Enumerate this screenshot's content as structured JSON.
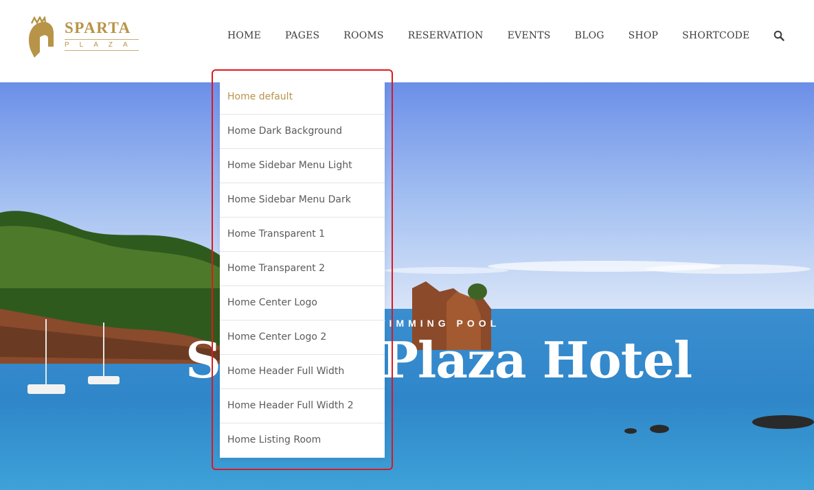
{
  "brand": {
    "name": "SPARTA",
    "sub": "PLAZA",
    "accent_color": "#b89448",
    "icon": "spartan-helmet-icon"
  },
  "nav": {
    "items": [
      "Home",
      "Pages",
      "Rooms",
      "Reservation",
      "Events",
      "Blog",
      "Shop",
      "Shortcode"
    ],
    "search_icon": "search-icon"
  },
  "dropdown": {
    "items": [
      "Home default",
      "Home Dark Background",
      "Home Sidebar Menu Light",
      "Home Sidebar Menu Dark",
      "Home Transparent 1",
      "Home Transparent 2",
      "Home Center Logo",
      "Home Center Logo 2",
      "Home Header Full Width",
      "Home Header Full Width 2",
      "Home Listing Room"
    ],
    "active_index": 0,
    "highlight_color": "#e0161d"
  },
  "hero": {
    "eyebrow": "SWIMMING POOL",
    "title": "Sparta Plaza Hotel"
  }
}
